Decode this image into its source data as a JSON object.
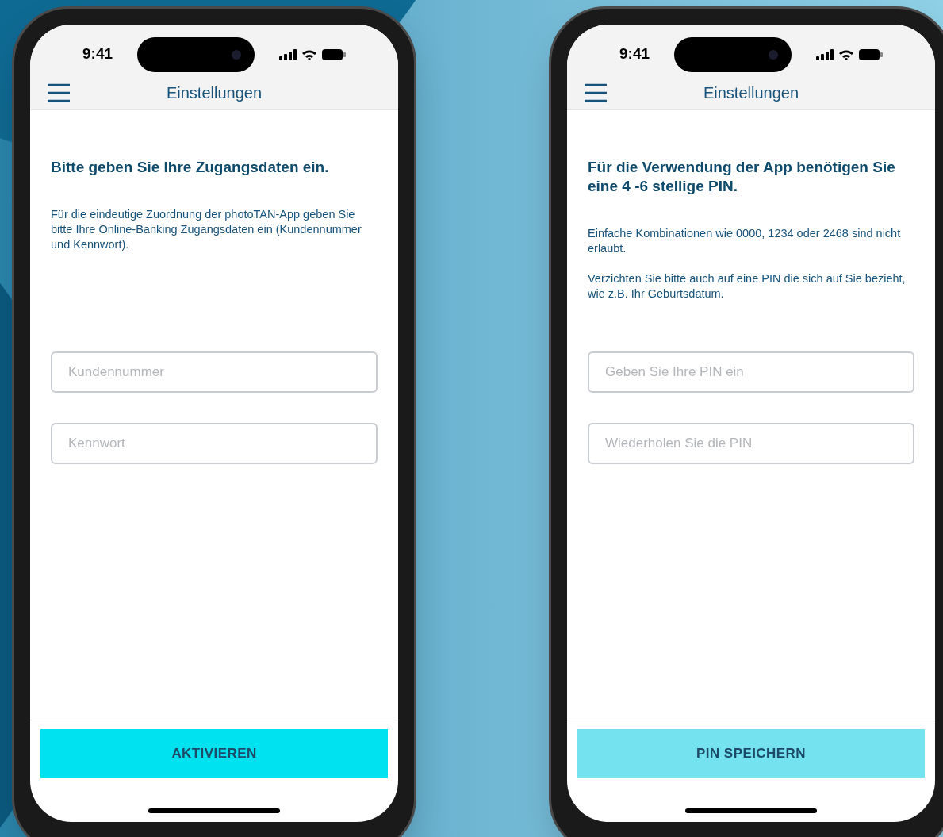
{
  "phones": [
    {
      "status_bar": {
        "time": "9:41"
      },
      "header": {
        "title": "Einstellungen"
      },
      "heading": "Bitte geben Sie Ihre Zugangsdaten ein.",
      "paragraphs": [
        "Für die eindeutige Zuordnung der photoTAN-App geben Sie bitte Ihre Online-Banking Zugangsdaten ein (Kundennummer und Kennwort)."
      ],
      "fields": [
        {
          "placeholder": "Kundennummer"
        },
        {
          "placeholder": "Kennwort"
        }
      ],
      "button": {
        "label": "AKTIVIEREN",
        "disabled": false
      }
    },
    {
      "status_bar": {
        "time": "9:41"
      },
      "header": {
        "title": "Einstellungen"
      },
      "heading": "Für die Verwendung der App benötigen Sie eine 4 -6 stellige PIN.",
      "paragraphs": [
        "Einfache Kombinationen wie 0000, 1234 oder 2468 sind nicht erlaubt.",
        "Verzichten Sie bitte auch auf eine PIN die sich auf Sie bezieht, wie z.B. Ihr Geburtsdatum."
      ],
      "fields": [
        {
          "placeholder": "Geben Sie Ihre PIN ein"
        },
        {
          "placeholder": "Wiederholen Sie die PIN"
        }
      ],
      "button": {
        "label": "PIN SPEICHERN",
        "disabled": true
      }
    }
  ]
}
